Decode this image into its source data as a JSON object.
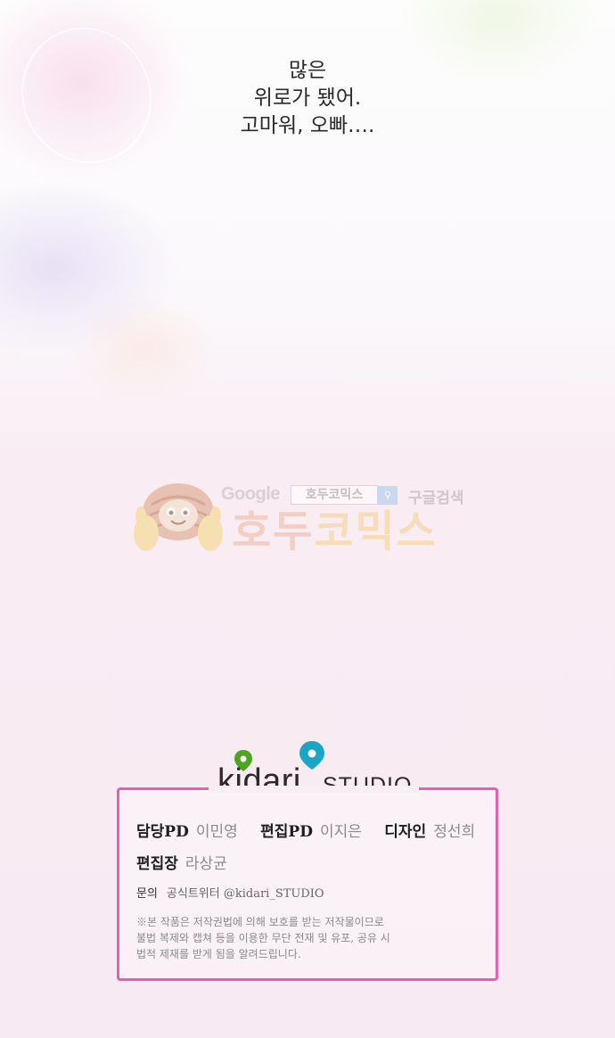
{
  "dialogue": {
    "lines": [
      "많은",
      "위로가 됐어.",
      "고마워, 오빠…."
    ]
  },
  "watermark": {
    "google": "Google",
    "search_box": "호두코믹스",
    "search_label": "구글검색",
    "title_part1": "호두",
    "title_part2": "코믹스"
  },
  "logo": {
    "brand": "kidari",
    "studio": "STUDIO",
    "colors": {
      "green_pin": "#4ea51f",
      "teal_pin": "#1aa6c4"
    }
  },
  "credits": {
    "border_color": "#e65fb0",
    "row1": [
      {
        "label": "담당PD",
        "value": "이민영"
      },
      {
        "label": "편집PD",
        "value": "이지은"
      },
      {
        "label": "디자인",
        "value": "정선희"
      }
    ],
    "row2": [
      {
        "label": "편집장",
        "value": "라상균"
      }
    ],
    "contact": {
      "label": "문의",
      "value": "공식트위터 @kidari_STUDIO"
    },
    "notice_lines": [
      "※본 작품은 저작권법에 의해 보호를 받는 저작물이므로",
      "불법 복제와 캡쳐 등을 이용한 무단 전재 및 유포, 공유 시",
      "법적 제재를 받게 됨을 알려드립니다."
    ]
  }
}
